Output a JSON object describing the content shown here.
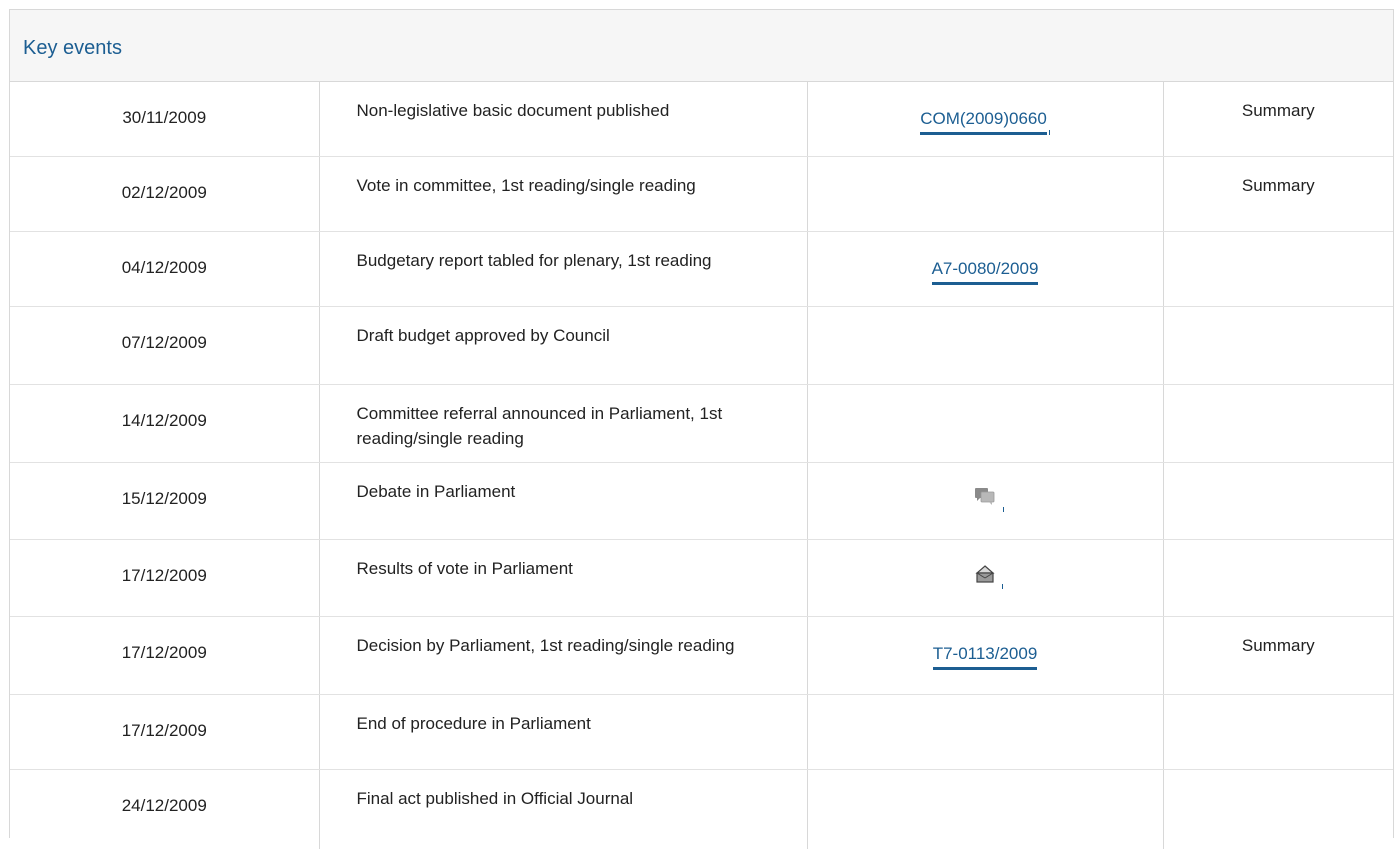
{
  "panel": {
    "title": "Key events"
  },
  "rows": [
    {
      "date": "30/11/2009",
      "event": "Non-legislative basic document published",
      "doc": "COM(2009)0660",
      "summary": "Summary"
    },
    {
      "date": "02/12/2009",
      "event": "Vote in committee, 1st reading/single reading",
      "doc": "",
      "summary": "Summary"
    },
    {
      "date": "04/12/2009",
      "event": "Budgetary report tabled for plenary, 1st reading",
      "doc": "A7-0080/2009",
      "summary": ""
    },
    {
      "date": "07/12/2009",
      "event": "Draft budget approved by Council",
      "doc": "",
      "summary": ""
    },
    {
      "date": "14/12/2009",
      "event": "Committee referral announced in Parliament, 1st reading/single reading",
      "doc": "",
      "summary": ""
    },
    {
      "date": "15/12/2009",
      "event": "Debate in Parliament",
      "doc_icon": "debate-icon",
      "summary": ""
    },
    {
      "date": "17/12/2009",
      "event": "Results of vote in Parliament",
      "doc_icon": "vote-results-icon",
      "summary": ""
    },
    {
      "date": "17/12/2009",
      "event": "Decision by Parliament, 1st reading/single reading",
      "doc": "T7-0113/2009",
      "summary": "Summary"
    },
    {
      "date": "17/12/2009",
      "event": "End of procedure in Parliament",
      "doc": "",
      "summary": ""
    },
    {
      "date": "24/12/2009",
      "event": "Final act published in Official Journal",
      "doc": "",
      "summary": ""
    }
  ],
  "colors": {
    "link": "#1c5e92",
    "header_bg": "#f6f6f6",
    "border": "#d8d8d8"
  }
}
